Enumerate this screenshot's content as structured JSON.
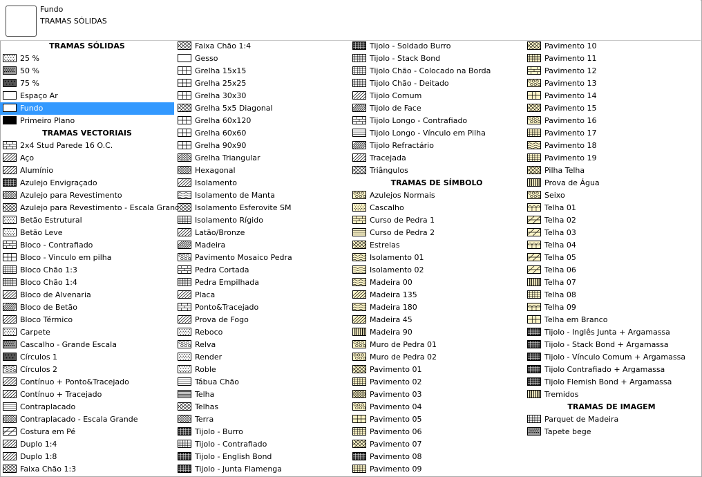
{
  "preview": {
    "name": "Fundo",
    "category": "TRAMAS SÓLIDAS"
  },
  "columns": [
    [
      {
        "t": "h",
        "label": "TRAMAS SÓLIDAS"
      },
      {
        "label": "25 %",
        "fill": "dots"
      },
      {
        "label": "50 %",
        "fill": "dots-dense"
      },
      {
        "label": "75 %",
        "fill": "dark"
      },
      {
        "label": "Espaço Ar",
        "fill": "empty"
      },
      {
        "label": "Fundo",
        "fill": "empty",
        "selected": true
      },
      {
        "label": "Primeiro Plano",
        "fill": "black"
      },
      {
        "t": "h",
        "label": "TRAMAS VECTORIAIS"
      },
      {
        "label": "2x4 Stud Parede 16 O.C.",
        "fill": "bricks"
      },
      {
        "label": "Aço",
        "fill": "diag"
      },
      {
        "label": "Alumínio",
        "fill": "diag"
      },
      {
        "label": "Azulejo Envigraçado",
        "fill": "checker"
      },
      {
        "label": "Azulejo para Revestimento",
        "fill": "cross-dense"
      },
      {
        "label": "Azulejo para Revestimento - Escala Grande",
        "fill": "cross"
      },
      {
        "label": "Betão Estrutural",
        "fill": "dots"
      },
      {
        "label": "Betão Leve",
        "fill": "dots"
      },
      {
        "label": "Bloco - Contrafiado",
        "fill": "bricks"
      },
      {
        "label": "Bloco - Vinculo em pilha",
        "fill": "grid"
      },
      {
        "label": "Bloco Chão 1:3",
        "fill": "grid-fine"
      },
      {
        "label": "Bloco Chão 1:4",
        "fill": "grid-fine"
      },
      {
        "label": "Bloco de Alvenaria",
        "fill": "diag"
      },
      {
        "label": "Bloco de Betão",
        "fill": "diag-dense"
      },
      {
        "label": "Bloco Térmico",
        "fill": "diag"
      },
      {
        "label": "Carpete",
        "fill": "dots"
      },
      {
        "label": "Cascalho - Grande Escala",
        "fill": "dots-dense"
      },
      {
        "label": "Círculos 1",
        "fill": "dark"
      },
      {
        "label": "Círculos 2",
        "fill": "circles"
      },
      {
        "label": "Contínuo + Ponto&Tracejado",
        "fill": "diag"
      },
      {
        "label": "Contínuo + Tracejado",
        "fill": "diag"
      },
      {
        "label": "Contraplacado",
        "fill": "hlines"
      },
      {
        "label": "Contraplacado - Escala Grande",
        "fill": "cross-dense"
      },
      {
        "label": "Costura em Pé",
        "fill": "diag-wide"
      },
      {
        "label": "Duplo 1:4",
        "fill": "diag"
      },
      {
        "label": "Duplo 1:8",
        "fill": "diag"
      },
      {
        "label": "Faixa Chão 1:3",
        "fill": "cross"
      }
    ],
    [
      {
        "label": "Faixa Chão 1:4",
        "fill": "cross"
      },
      {
        "label": "Gesso",
        "fill": "empty"
      },
      {
        "label": "Grelha 15x15",
        "fill": "grid"
      },
      {
        "label": "Grelha 25x25",
        "fill": "grid"
      },
      {
        "label": "Grelha 30x30",
        "fill": "grid"
      },
      {
        "label": "Grelha 5x5 Diagonal",
        "fill": "cross"
      },
      {
        "label": "Grelha 60x120",
        "fill": "grid"
      },
      {
        "label": "Grelha 60x60",
        "fill": "grid"
      },
      {
        "label": "Grelha 90x90",
        "fill": "grid"
      },
      {
        "label": "Grelha Triangular",
        "fill": "cross-dense"
      },
      {
        "label": "Hexagonal",
        "fill": "cross-dense"
      },
      {
        "label": "Isolamento",
        "fill": "diag"
      },
      {
        "label": "Isolamento de Manta",
        "fill": "waves"
      },
      {
        "label": "Isolamento Esferovite SM",
        "fill": "cross"
      },
      {
        "label": "Isolamento Rígido",
        "fill": "grid-fine"
      },
      {
        "label": "Latão/Bronze",
        "fill": "diag"
      },
      {
        "label": "Madeira",
        "fill": "diag-dense"
      },
      {
        "label": "Pavimento Mosaico Pedra",
        "fill": "circles"
      },
      {
        "label": "Pedra Cortada",
        "fill": "bricks"
      },
      {
        "label": "Pedra Empilhada",
        "fill": "grid-fine"
      },
      {
        "label": "Placa",
        "fill": "diag"
      },
      {
        "label": "Ponto&Tracejado",
        "fill": "bricks"
      },
      {
        "label": "Prova de Fogo",
        "fill": "diag"
      },
      {
        "label": "Reboco",
        "fill": "dots"
      },
      {
        "label": "Relva",
        "fill": "circles"
      },
      {
        "label": "Render",
        "fill": "dots"
      },
      {
        "label": "Roble",
        "fill": "dots"
      },
      {
        "label": "Tábua Chão",
        "fill": "hlines"
      },
      {
        "label": "Telha",
        "fill": "hlines-dense"
      },
      {
        "label": "Telhas",
        "fill": "cross"
      },
      {
        "label": "Terra",
        "fill": "cross-dense"
      },
      {
        "label": "Tijolo - Burro",
        "fill": "checker"
      },
      {
        "label": "Tijolo - Contrafiado",
        "fill": "grid-fine"
      },
      {
        "label": "Tijolo - English Bond",
        "fill": "checker"
      },
      {
        "label": "Tijolo - Junta Flamenga",
        "fill": "checker"
      }
    ],
    [
      {
        "label": "Tijolo - Soldado Burro",
        "fill": "checker"
      },
      {
        "label": "Tijolo - Stack Bond",
        "fill": "grid-fine"
      },
      {
        "label": "Tijolo Chão - Colocado na Borda",
        "fill": "grid-fine"
      },
      {
        "label": "Tijolo Chão - Deitado",
        "fill": "grid-fine"
      },
      {
        "label": "Tijolo Comum",
        "fill": "diag"
      },
      {
        "label": "Tijolo de Face",
        "fill": "diag-dense"
      },
      {
        "label": "Tijolo Longo - Contrafiado",
        "fill": "bricks"
      },
      {
        "label": "Tijolo Longo - Vínculo em Pilha",
        "fill": "hlines"
      },
      {
        "label": "Tijolo Refractário",
        "fill": "diag-dense"
      },
      {
        "label": "Tracejada",
        "fill": "diag"
      },
      {
        "label": "Triângulos",
        "fill": "cross"
      },
      {
        "t": "h",
        "label": "TRAMAS DE SÍMBOLO"
      },
      {
        "label": "Azulejos Normais",
        "fill": "circles",
        "y": 1
      },
      {
        "label": "Cascalho",
        "fill": "dots",
        "y": 1
      },
      {
        "label": "Curso de Pedra 1",
        "fill": "bricks",
        "y": 1
      },
      {
        "label": "Curso de Pedra 2",
        "fill": "hlines",
        "y": 1
      },
      {
        "label": "Estrelas",
        "fill": "cross",
        "y": 1
      },
      {
        "label": "Isolamento 01",
        "fill": "waves",
        "y": 1
      },
      {
        "label": "Isolamento 02",
        "fill": "waves",
        "y": 1
      },
      {
        "label": "Madeira 00",
        "fill": "waves",
        "y": 1
      },
      {
        "label": "Madeira 135",
        "fill": "diag",
        "y": 1
      },
      {
        "label": "Madeira 180",
        "fill": "waves",
        "y": 1
      },
      {
        "label": "Madeira 45",
        "fill": "diag",
        "y": 1
      },
      {
        "label": "Madeira 90",
        "fill": "vlines",
        "y": 1
      },
      {
        "label": "Muro de Pedra 01",
        "fill": "circles",
        "y": 1
      },
      {
        "label": "Muro de Pedra 02",
        "fill": "circles",
        "y": 1
      },
      {
        "label": "Pavimento 01",
        "fill": "cross",
        "y": 1
      },
      {
        "label": "Pavimento 02",
        "fill": "grid-fine",
        "y": 1
      },
      {
        "label": "Pavimento 03",
        "fill": "cross-dense",
        "y": 1
      },
      {
        "label": "Pavimento 04",
        "fill": "circles",
        "y": 1
      },
      {
        "label": "Pavimento 05",
        "fill": "grid",
        "y": 1
      },
      {
        "label": "Pavimento 06",
        "fill": "grid-fine",
        "y": 1
      },
      {
        "label": "Pavimento 07",
        "fill": "cross",
        "y": 1
      },
      {
        "label": "Pavimento 08",
        "fill": "checker",
        "y": 1
      },
      {
        "label": "Pavimento 09",
        "fill": "grid-fine",
        "y": 1
      }
    ],
    [
      {
        "label": "Pavimento 10",
        "fill": "cross",
        "y": 1
      },
      {
        "label": "Pavimento 11",
        "fill": "grid-fine",
        "y": 1
      },
      {
        "label": "Pavimento 12",
        "fill": "bricks",
        "y": 1
      },
      {
        "label": "Pavimento 13",
        "fill": "circles",
        "y": 1
      },
      {
        "label": "Pavimento 14",
        "fill": "grid",
        "y": 1
      },
      {
        "label": "Pavimento 15",
        "fill": "cross",
        "y": 1
      },
      {
        "label": "Pavimento 16",
        "fill": "circles",
        "y": 1
      },
      {
        "label": "Pavimento 17",
        "fill": "grid-fine",
        "y": 1
      },
      {
        "label": "Pavimento 18",
        "fill": "waves",
        "y": 1
      },
      {
        "label": "Pavimento 19",
        "fill": "grid-fine",
        "y": 1
      },
      {
        "label": "Pilha Telha",
        "fill": "cross",
        "y": 1
      },
      {
        "label": "Prova de Água",
        "fill": "vlines",
        "y": 1
      },
      {
        "label": "Seixo",
        "fill": "circles",
        "y": 1
      },
      {
        "label": "Telha 01",
        "fill": "arcs",
        "y": 1
      },
      {
        "label": "Telha 02",
        "fill": "diag-wide",
        "y": 1
      },
      {
        "label": "Telha 03",
        "fill": "diag-wide",
        "y": 1
      },
      {
        "label": "Telha 04",
        "fill": "arcs",
        "y": 1
      },
      {
        "label": "Telha 05",
        "fill": "diag-wide",
        "y": 1
      },
      {
        "label": "Telha 06",
        "fill": "diag-wide",
        "y": 1
      },
      {
        "label": "Telha 07",
        "fill": "vlines",
        "y": 1
      },
      {
        "label": "Telha 08",
        "fill": "grid-fine",
        "y": 1
      },
      {
        "label": "Telha 09",
        "fill": "arcs",
        "y": 1
      },
      {
        "label": "Telha em Branco",
        "fill": "grid",
        "y": 1
      },
      {
        "label": "Tijolo - Inglês Junta + Argamassa",
        "fill": "checker"
      },
      {
        "label": "Tijolo - Stack Bond + Argamassa",
        "fill": "checker"
      },
      {
        "label": "Tijolo - Vínculo Comum + Argamassa",
        "fill": "checker"
      },
      {
        "label": "Tijolo Contrafiado + Argamassa",
        "fill": "checker"
      },
      {
        "label": "Tijolo Flemish Bond + Argamassa",
        "fill": "checker"
      },
      {
        "label": "Tremidos",
        "fill": "vlines",
        "y": 1
      },
      {
        "t": "h",
        "label": "TRAMAS DE IMAGEM"
      },
      {
        "label": "Parquet de Madeira",
        "fill": "grid-fine"
      },
      {
        "label": "Tapete bege",
        "fill": "dots-dense"
      }
    ]
  ],
  "colors": {
    "selection": "#3399ff",
    "symbol_background": "#fdf5c8",
    "border": "#a9a9a9"
  }
}
